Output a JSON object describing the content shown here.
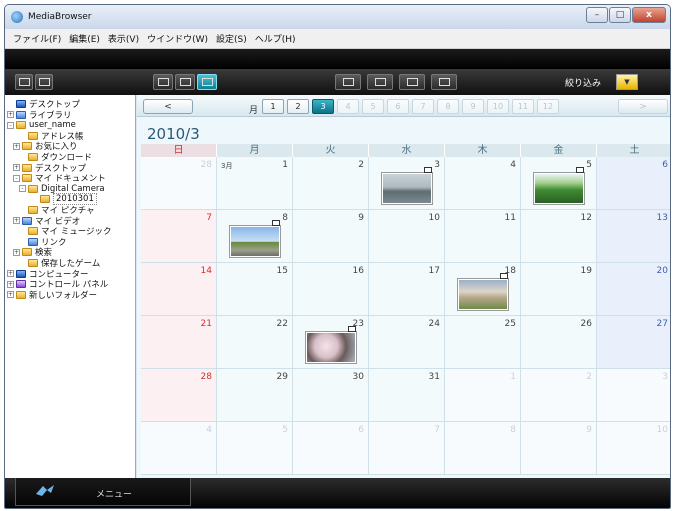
{
  "window": {
    "title": "MediaBrowser",
    "controls": [
      "–",
      "□",
      "x"
    ]
  },
  "menu": [
    "ファイル(F)",
    "編集(E)",
    "表示(V)",
    "ウインドウ(W)",
    "設定(S)",
    "ヘルプ(H)"
  ],
  "toolbar": {
    "filter_label": "絞り込み"
  },
  "tree": [
    {
      "label": "デスクトップ",
      "icon": "monitor",
      "expander": ""
    },
    {
      "label": "ライブラリ",
      "icon": "blue",
      "expander": "+"
    },
    {
      "label": "user_name",
      "icon": "folder",
      "expander": "-"
    },
    {
      "label": "アドレス帳",
      "icon": "folder",
      "expander": ""
    },
    {
      "label": "お気に入り",
      "icon": "folder",
      "expander": "+"
    },
    {
      "label": "ダウンロード",
      "icon": "folder",
      "expander": ""
    },
    {
      "label": "デスクトップ",
      "icon": "folder",
      "expander": "+"
    },
    {
      "label": "マイ ドキュメント",
      "icon": "folder",
      "expander": "-"
    },
    {
      "label": "Digital Camera",
      "icon": "folder",
      "expander": "-"
    },
    {
      "label": "2010301",
      "icon": "folder",
      "expander": ""
    },
    {
      "label": "マイ ピクチャ",
      "icon": "folder",
      "expander": ""
    },
    {
      "label": "マイ ビデオ",
      "icon": "blue",
      "expander": "+"
    },
    {
      "label": "マイ ミュージック",
      "icon": "folder",
      "expander": ""
    },
    {
      "label": "リンク",
      "icon": "blue",
      "expander": ""
    },
    {
      "label": "検索",
      "icon": "folder",
      "expander": "+"
    },
    {
      "label": "保存したゲーム",
      "icon": "folder",
      "expander": ""
    },
    {
      "label": "コンピューター",
      "icon": "monitor",
      "expander": "+"
    },
    {
      "label": "コントロール パネル",
      "icon": "purple",
      "expander": "+"
    },
    {
      "label": "新しいフォルダー",
      "icon": "folder",
      "expander": "+"
    }
  ],
  "calendar": {
    "prev_label": "<",
    "next_label": ">",
    "month_word": "月",
    "months": [
      "1",
      "2",
      "3",
      "4",
      "5",
      "6",
      "7",
      "8",
      "9",
      "10",
      "11",
      "12"
    ],
    "current_month": "3",
    "heading": "2010/3",
    "weekdays": [
      "日",
      "月",
      "火",
      "水",
      "木",
      "金",
      "土"
    ],
    "month_tag": "3月",
    "days": [
      [
        "28",
        "1",
        "2",
        "3",
        "4",
        "5",
        "6"
      ],
      [
        "7",
        "8",
        "9",
        "10",
        "11",
        "12",
        "13"
      ],
      [
        "14",
        "15",
        "16",
        "17",
        "18",
        "19",
        "20"
      ],
      [
        "21",
        "22",
        "23",
        "24",
        "25",
        "26",
        "27"
      ],
      [
        "28",
        "29",
        "30",
        "31",
        "1",
        "2",
        "3"
      ],
      [
        "4",
        "5",
        "6",
        "7",
        "8",
        "9",
        "10"
      ]
    ],
    "photos": [
      {
        "row": 0,
        "col": 3,
        "scene": "lake"
      },
      {
        "row": 0,
        "col": 5,
        "scene": "trees"
      },
      {
        "row": 1,
        "col": 1,
        "scene": "road"
      },
      {
        "row": 2,
        "col": 4,
        "scene": "village"
      },
      {
        "row": 3,
        "col": 2,
        "scene": "blossom"
      }
    ]
  },
  "bottom": {
    "menu_label": "メニュー"
  }
}
